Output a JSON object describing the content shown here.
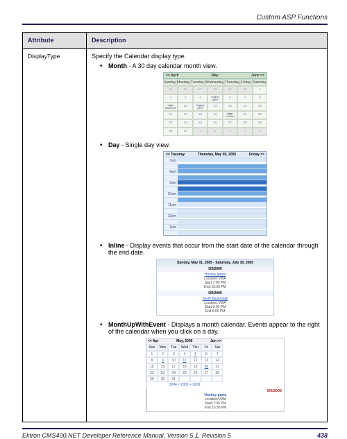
{
  "header": {
    "section": "Custom ASP Functions"
  },
  "table": {
    "headers": {
      "attr": "Attribute",
      "desc": "Description"
    },
    "row": {
      "name": "DisplayType",
      "lede": "Specify the Calendar display type.",
      "options": {
        "month": {
          "label": "Month",
          "desc": " - A 30 day calendar month view."
        },
        "day": {
          "label": "Day",
          "desc": " - Single day view."
        },
        "inline": {
          "label": "Inline",
          "desc": " - Display events that occur from the start date of the calendar through the end date."
        },
        "mue": {
          "label": "MonthUpWithEvent",
          "desc": " - Displays a month calendar. Events appear to the right of the calendar when you click on a day."
        }
      }
    }
  },
  "thumbs": {
    "month": {
      "nav_prev": "<< April",
      "title": "May",
      "nav_next": "June >>",
      "dow": [
        "Sunday",
        "Monday",
        "Tuesday",
        "Wednesday",
        "Thursday",
        "Friday",
        "Saturday"
      ],
      "cells": [
        {
          "n": "25",
          "dim": true
        },
        {
          "n": "26",
          "dim": true
        },
        {
          "n": "27",
          "dim": true
        },
        {
          "n": "28",
          "dim": true
        },
        {
          "n": "29",
          "dim": true
        },
        {
          "n": "30",
          "dim": true
        },
        {
          "n": "1"
        },
        {
          "n": "2"
        },
        {
          "n": "3"
        },
        {
          "n": "4"
        },
        {
          "n": "5",
          "ev": "Hockey game"
        },
        {
          "n": "6"
        },
        {
          "n": "7"
        },
        {
          "n": "8"
        },
        {
          "n": "9",
          "ev": "Youth Basketball"
        },
        {
          "n": "10"
        },
        {
          "n": "11",
          "ev": "Hockey game"
        },
        {
          "n": "12"
        },
        {
          "n": "13"
        },
        {
          "n": "14"
        },
        {
          "n": "15"
        },
        {
          "n": "16"
        },
        {
          "n": "17"
        },
        {
          "n": "18"
        },
        {
          "n": "19"
        },
        {
          "n": "20",
          "ev": "Arena Football"
        },
        {
          "n": "21"
        },
        {
          "n": "22"
        },
        {
          "n": "23"
        },
        {
          "n": "24"
        },
        {
          "n": "25"
        },
        {
          "n": "26"
        },
        {
          "n": "27"
        },
        {
          "n": "28"
        },
        {
          "n": "29"
        },
        {
          "n": "30"
        },
        {
          "n": "31"
        },
        {
          "n": "1",
          "dim": true
        },
        {
          "n": "2",
          "dim": true
        },
        {
          "n": "3",
          "dim": true
        },
        {
          "n": "4",
          "dim": true
        },
        {
          "n": "5",
          "dim": true
        }
      ]
    },
    "day": {
      "nav_prev": "<< Tuesday",
      "title": "Thursday, May 05, 2005",
      "nav_next": "Friday >>",
      "slots": [
        {
          "t": "7am",
          "c": "free"
        },
        {
          "t": "",
          "c": "busy1"
        },
        {
          "t": "8am",
          "c": "busy1"
        },
        {
          "t": "",
          "c": "busy1"
        },
        {
          "t": "9am",
          "c": "busy2"
        },
        {
          "t": "",
          "c": "busy2"
        },
        {
          "t": "10am",
          "c": "busy1"
        },
        {
          "t": "",
          "c": "busy1"
        },
        {
          "t": "11am",
          "c": "free"
        },
        {
          "t": "",
          "c": "free"
        },
        {
          "t": "12pm",
          "c": "free"
        },
        {
          "t": "",
          "c": "free"
        },
        {
          "t": "1pm",
          "c": "free"
        },
        {
          "t": "",
          "c": "free"
        }
      ]
    },
    "inline": {
      "range": "Sunday, May 01, 2005 - Saturday, July 30, 2005",
      "groups": [
        {
          "date": "5/5/2005",
          "events": [
            {
              "title": "Hockey game",
              "loc": "Location:VWA",
              "start": "Start:7:00 PM",
              "end": "End:10:30 PM"
            }
          ]
        },
        {
          "date": "5/9/2005",
          "events": [
            {
              "title": "Youth Basketball",
              "loc": "Location:VWA",
              "start": "Start:3:00 PM",
              "end": "End:6:00 PM"
            }
          ]
        }
      ]
    },
    "mue": {
      "nav_prev": "<< Apr",
      "title": "May, 2005",
      "nav_next": "Jun >>",
      "dow": [
        "Sun",
        "Mon",
        "Tue",
        "Wed",
        "Thu",
        "Fri",
        "Sat"
      ],
      "days": [
        "1",
        "2",
        "3",
        "4",
        "5",
        "6",
        "7",
        "8",
        "9",
        "10",
        "11",
        "12",
        "13",
        "14",
        "15",
        "16",
        "17",
        "18",
        "19",
        "20",
        "21",
        "22",
        "23",
        "24",
        "25",
        "26",
        "27",
        "28",
        "29",
        "30",
        "31",
        "",
        "",
        "",
        ""
      ],
      "link_days": [
        "5",
        "9",
        "11",
        "20"
      ],
      "years": "2004 < 2005 > 2006",
      "panel": {
        "date": "5/5/2005",
        "title": "Hockey game",
        "loc": "Location:VWA",
        "start": "Start:7:00 PM",
        "end": "End:10:30 PM"
      }
    }
  },
  "footer": {
    "left": "Ektron CMS400.NET Developer Reference Manual, Version 5.1, Revision 5",
    "page": "438"
  }
}
